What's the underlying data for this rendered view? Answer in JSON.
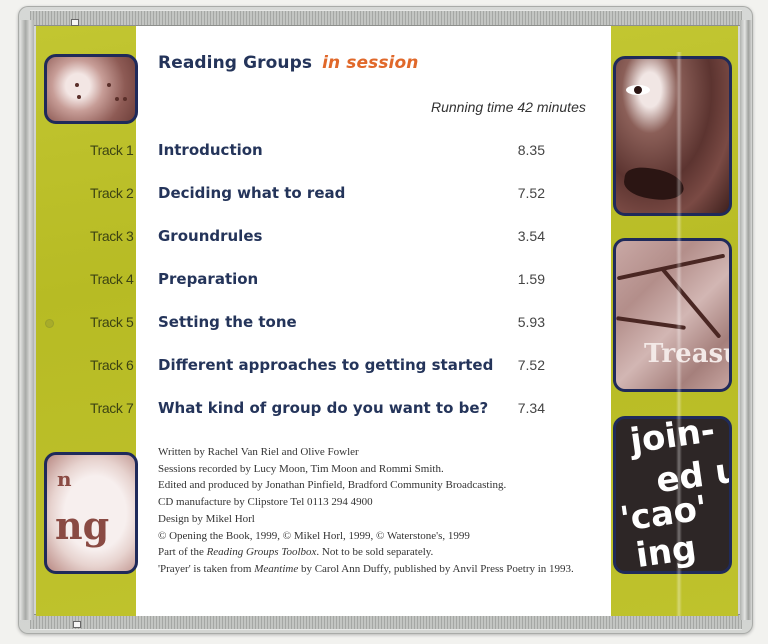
{
  "header": {
    "title_main": "Reading Groups",
    "title_accent": "in session",
    "running_time": "Running time 42 minutes"
  },
  "colors": {
    "band": "#bcc02a",
    "title_navy": "#24345a",
    "accent_orange": "#e0682a",
    "frame_navy": "#1f2a5a"
  },
  "tracks": [
    {
      "number": "Track 1",
      "title": "Introduction",
      "time": "8.35"
    },
    {
      "number": "Track 2",
      "title": "Deciding what to read",
      "time": "7.52"
    },
    {
      "number": "Track 3",
      "title": "Groundrules",
      "time": "3.54"
    },
    {
      "number": "Track 4",
      "title": "Preparation",
      "time": "1.59"
    },
    {
      "number": "Track 5",
      "title": "Setting the tone",
      "time": "5.93"
    },
    {
      "number": "Track 6",
      "title": "Different approaches to getting started",
      "time": "7.52"
    },
    {
      "number": "Track 7",
      "title": "What kind of group do you want to be?",
      "time": "7.34"
    }
  ],
  "credits": {
    "line1": "Written by Rachel Van Riel and Olive Fowler",
    "line2": "Sessions recorded by Lucy Moon, Tim Moon and Rommi Smith.",
    "line3": "Edited and produced by Jonathan Pinfield, Bradford Community Broadcasting.",
    "line4": "CD manufacture by Clipstore Tel 0113 294 4900",
    "line5": "Design by Mikel Horl",
    "line6": "© Opening the Book, 1999, © Mikel Horl, 1999, © Waterstone's, 1999",
    "line7_prefix": "Part of the ",
    "line7_italic": "Reading Groups Toolbox",
    "line7_suffix": ". Not to be sold separately.",
    "line8_prefix": "'Prayer' is taken from ",
    "line8_italic": "Meantime",
    "line8_suffix": " by Carol Ann Duffy, published by Anvil Press Poetry in 1993."
  },
  "images": {
    "bottom_left_text": "ng",
    "bottom_left_small": "n",
    "middle_right_text": "Treasu",
    "bottom_right_words": [
      "join-",
      "ed up",
      "'cao'",
      "ing"
    ]
  }
}
